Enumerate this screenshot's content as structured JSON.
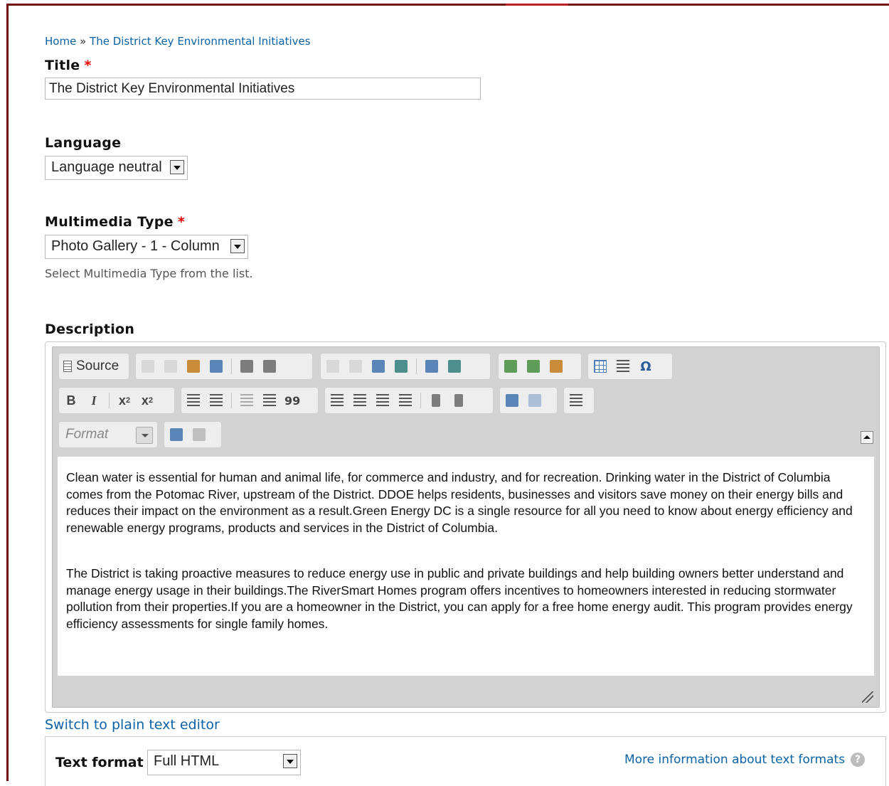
{
  "breadcrumb": {
    "home": "Home",
    "separator": "»",
    "current": "The District Key Environmental Initiatives"
  },
  "title_field": {
    "label": "Title",
    "required_mark": "*",
    "value": "The District Key Environmental Initiatives"
  },
  "language_field": {
    "label": "Language",
    "value": "Language neutral"
  },
  "multimedia_field": {
    "label": "Multimedia Type",
    "required_mark": "*",
    "value": "Photo Gallery - 1 - Column",
    "hint": "Select Multimedia Type from the list."
  },
  "description": {
    "label": "Description",
    "toolbar": {
      "source_label": "Source",
      "bold": "B",
      "italic": "I",
      "format_placeholder": "Format",
      "omega": "Ω",
      "quote": "99"
    },
    "paragraphs": [
      "Clean water is essential for human and animal life, for commerce and industry, and for recreation. Drinking water in the District of Columbia comes from the Potomac River, upstream of the District. DDOE helps residents, businesses and visitors save money on their energy bills and reduces their impact on the environment as a result.Green Energy DC is a single resource for all you need to know about energy efficiency and renewable energy programs, products and services in the District of Columbia.",
      "The District is taking proactive measures to reduce energy use in public and private buildings and help building owners better understand and manage energy usage in their buildings.The RiverSmart Homes program offers incentives to homeowners interested in reducing stormwater pollution from their properties.If you are a homeowner in the District, you can apply for a free home energy audit. This program provides energy efficiency assessments for single family homes."
    ]
  },
  "switch_link": "Switch to plain text editor",
  "text_format": {
    "label": "Text format",
    "value": "Full HTML",
    "more_info": "More information about text formats",
    "help_glyph": "?"
  }
}
